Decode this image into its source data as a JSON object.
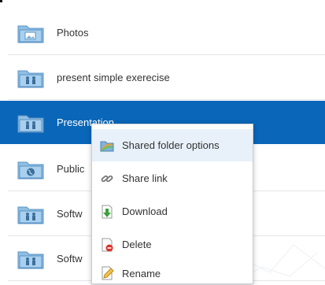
{
  "folders": [
    {
      "label": "Photos",
      "icon": "folder-image-icon"
    },
    {
      "label": "present simple exerecise",
      "icon": "folder-shared-icon"
    },
    {
      "label": "Presentation",
      "icon": "folder-shared-icon",
      "selected": true
    },
    {
      "label": "Public",
      "icon": "folder-globe-icon"
    },
    {
      "label": "Softw",
      "icon": "folder-shared-icon"
    },
    {
      "label": "Softw",
      "icon": "folder-shared-icon"
    }
  ],
  "context_menu": {
    "items": [
      {
        "label": "Shared folder options",
        "icon": "shared-folder-options-icon"
      },
      {
        "label": "Share link",
        "icon": "link-icon"
      },
      {
        "label": "Download",
        "icon": "download-icon"
      },
      {
        "label": "Delete",
        "icon": "delete-icon"
      },
      {
        "label": "Rename",
        "icon": "rename-icon"
      }
    ]
  },
  "colors": {
    "selection": "#0a66b8",
    "hover": "#e8f0f9",
    "folder": "#7fb3db"
  }
}
